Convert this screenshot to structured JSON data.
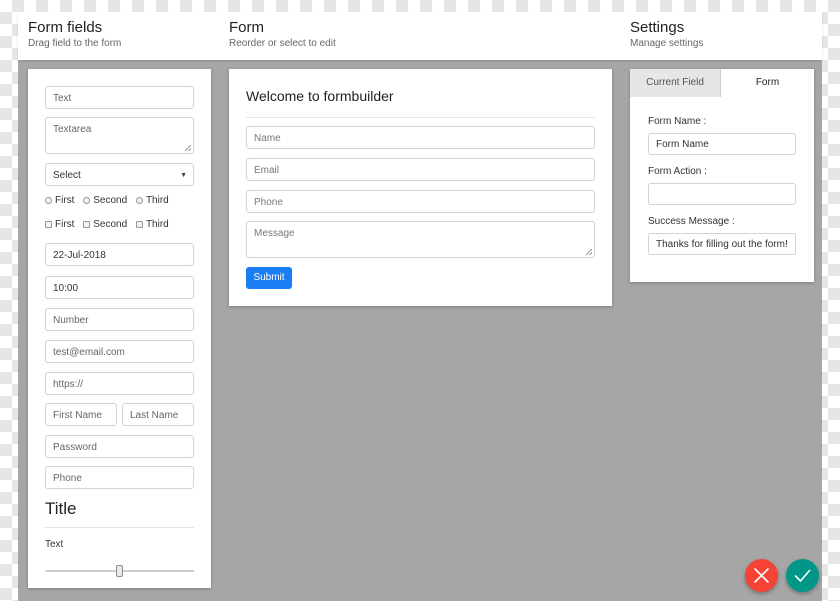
{
  "header": {
    "fields": {
      "title": "Form fields",
      "subtitle": "Drag field to the form"
    },
    "form": {
      "title": "Form",
      "subtitle": "Reorder or select to edit"
    },
    "settings": {
      "title": "Settings",
      "subtitle": "Manage settings"
    }
  },
  "palette": {
    "text": "Text",
    "textarea": "Textarea",
    "select": "Select",
    "radios": [
      "First",
      "Second",
      "Third"
    ],
    "checkboxes": [
      "First",
      "Second",
      "Third"
    ],
    "date": "22-Jul-2018",
    "time": "10:00",
    "number": "Number",
    "email": "test@email.com",
    "url": "https://",
    "first_name": "First Name",
    "last_name": "Last Name",
    "password": "Password",
    "phone": "Phone",
    "title": "Title",
    "static_text": "Text",
    "slider_value": 0.5
  },
  "form": {
    "title": "Welcome to formbuilder",
    "fields": {
      "name": "Name",
      "email": "Email",
      "phone": "Phone",
      "message": "Message"
    },
    "submit_label": "Submit"
  },
  "settings": {
    "tabs": {
      "current": "Current Field",
      "form": "Form"
    },
    "form_name_label": "Form Name :",
    "form_name_value": "Form Name",
    "form_action_label": "Form Action :",
    "form_action_value": "",
    "success_label": "Success Message :",
    "success_value": "Thanks for filling out the form!"
  },
  "actions": {
    "cancel_icon": "close-icon",
    "confirm_icon": "check-icon"
  },
  "colors": {
    "primary": "#1a7ef2",
    "cancel": "#f44336",
    "confirm": "#009688",
    "canvas": "#a6a6a6"
  }
}
